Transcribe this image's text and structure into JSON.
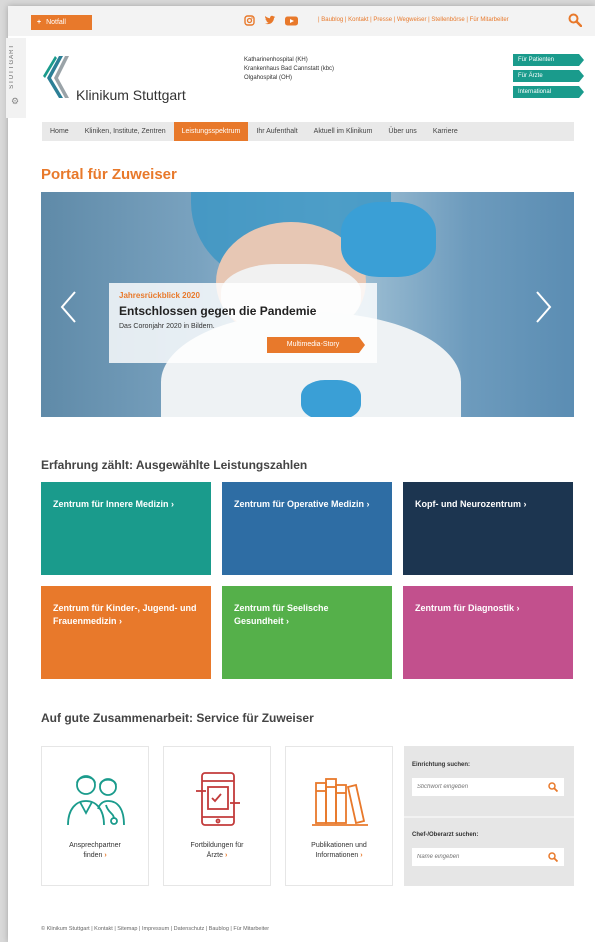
{
  "topbar": {
    "notfall_label": "Notfall",
    "social_icons": [
      "instagram-icon",
      "twitter-icon",
      "youtube-icon"
    ],
    "links_text": "| Baublog | Kontakt | Presse | Wegweiser | Stellenbörse | Für Mitarbeiter"
  },
  "sidebar": {
    "label": "STUTTGART"
  },
  "header": {
    "logo_text": "Klinikum Stuttgart",
    "hospitals": [
      "Katharinenhospital (KH)",
      "Krankenhaus Bad Cannstatt (kbc)",
      "Olgahospital (OH)"
    ],
    "audience_buttons": [
      "Für Patienten",
      "Für Ärzte",
      "International"
    ]
  },
  "nav": {
    "items": [
      "Home",
      "Kliniken, Institute, Zentren",
      "Leistungsspektrum",
      "Ihr Aufenthalt",
      "Aktuell im Klinikum",
      "Über uns",
      "Karriere"
    ],
    "active_index": 2
  },
  "page_title": "Portal für Zuweiser",
  "hero": {
    "kicker": "Jahresrückblick 2020",
    "title": "Entschlossen gegen die Pandemie",
    "subtitle": "Das Coronjahr 2020 in Bildern.",
    "button_label": "Multimedia-Story"
  },
  "section1_title": "Erfahrung zählt: Ausgewählte Leistungszahlen",
  "tiles": [
    {
      "label": "Zentrum für Innere Medizin ›",
      "color": "#1a9b8c"
    },
    {
      "label": "Zentrum für Operative Medizin ›",
      "color": "#2e6da4"
    },
    {
      "label": "Kopf- und Neurozentrum ›",
      "color": "#1c3550"
    },
    {
      "label": "Zentrum für Kinder-, Jugend- und Frauenmedizin ›",
      "color": "#e8792b"
    },
    {
      "label": "Zentrum für Seelische Gesundheit ›",
      "color": "#55b04a"
    },
    {
      "label": "Zentrum für Diagnostik ›",
      "color": "#c2508d"
    }
  ],
  "section2_title": "Auf gute Zusammenarbeit: Service für Zuweiser",
  "services": [
    {
      "line1": "Ansprechpartner",
      "line2": "finden",
      "icon": "doctors-icon"
    },
    {
      "line1": "Fortbildungen für",
      "line2": "Ärzte",
      "icon": "tablet-training-icon"
    },
    {
      "line1": "Publikationen und",
      "line2": "Informationen",
      "icon": "books-icon"
    }
  ],
  "search": {
    "facility_label": "Einrichtung suchen:",
    "facility_placeholder": "Stichwort eingeben",
    "doctor_label": "Chef-/Oberarzt suchen:",
    "doctor_placeholder": "Name eingeben"
  },
  "footer": "© Klinikum Stuttgart | Kontakt | Sitemap | Impressum | Datenschutz | Baublog | Für Mitarbeiter",
  "colors": {
    "brand_orange": "#e8792b",
    "brand_teal": "#1a9b8c"
  }
}
